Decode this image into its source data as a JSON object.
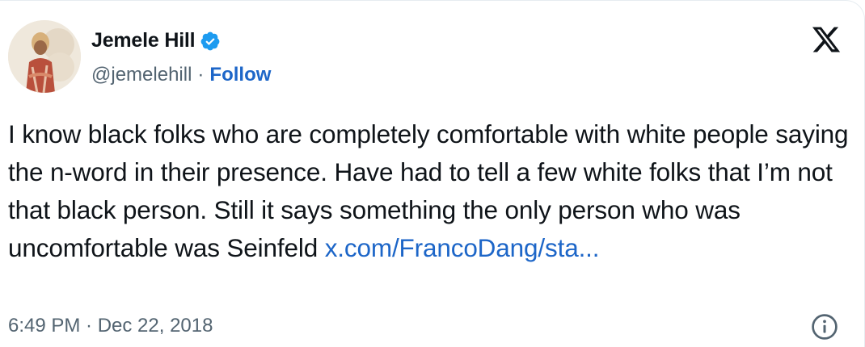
{
  "author": {
    "name": "Jemele Hill",
    "handle": "@jemelehill",
    "verified_icon": "verified-badge-icon",
    "separator": "·",
    "follow_label": "Follow"
  },
  "tweet": {
    "text": "I know black folks who are completely comfortable with white people saying the n-word in their presence. Have had to tell a few white folks that I’m not that black person. Still it says something the only person who was uncomfortable was Seinfeld",
    "link_text": "x.com/FrancoDang/sta...",
    "timestamp": "6:49 PM · Dec 22, 2018"
  },
  "icons": {
    "brand": "x-logo-icon",
    "info": "info-icon"
  },
  "colors": {
    "text": "#0f1419",
    "secondary": "#536471",
    "link": "#1d66c8",
    "verified": "#1d9bf0"
  }
}
